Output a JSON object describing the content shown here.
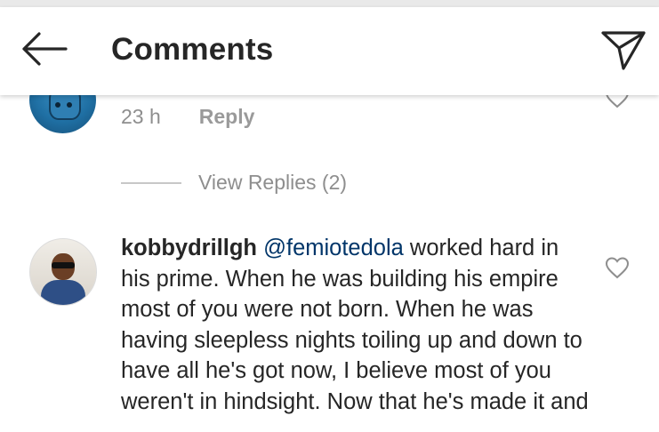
{
  "header": {
    "title": "Comments",
    "back_icon": "arrow-left-icon",
    "share_icon": "paper-plane-icon"
  },
  "previous_comment": {
    "time": "23 h",
    "reply_label": "Reply",
    "like_icon": "heart-outline-icon"
  },
  "view_replies": {
    "label": "View Replies (2)"
  },
  "comment": {
    "username": "kobbydrillgh",
    "mention": "@femiotedola",
    "text": " worked hard in his prime. When he was building his empire most of you were not born. When he was having sleepless nights toiling up and down to have all he's got now, I believe most of you weren't in hindsight. Now that he's made it and",
    "like_icon": "heart-outline-icon"
  },
  "colors": {
    "text": "#262626",
    "muted": "#8e8e8e",
    "mention": "#003569",
    "divider": "#c7c7c7"
  }
}
